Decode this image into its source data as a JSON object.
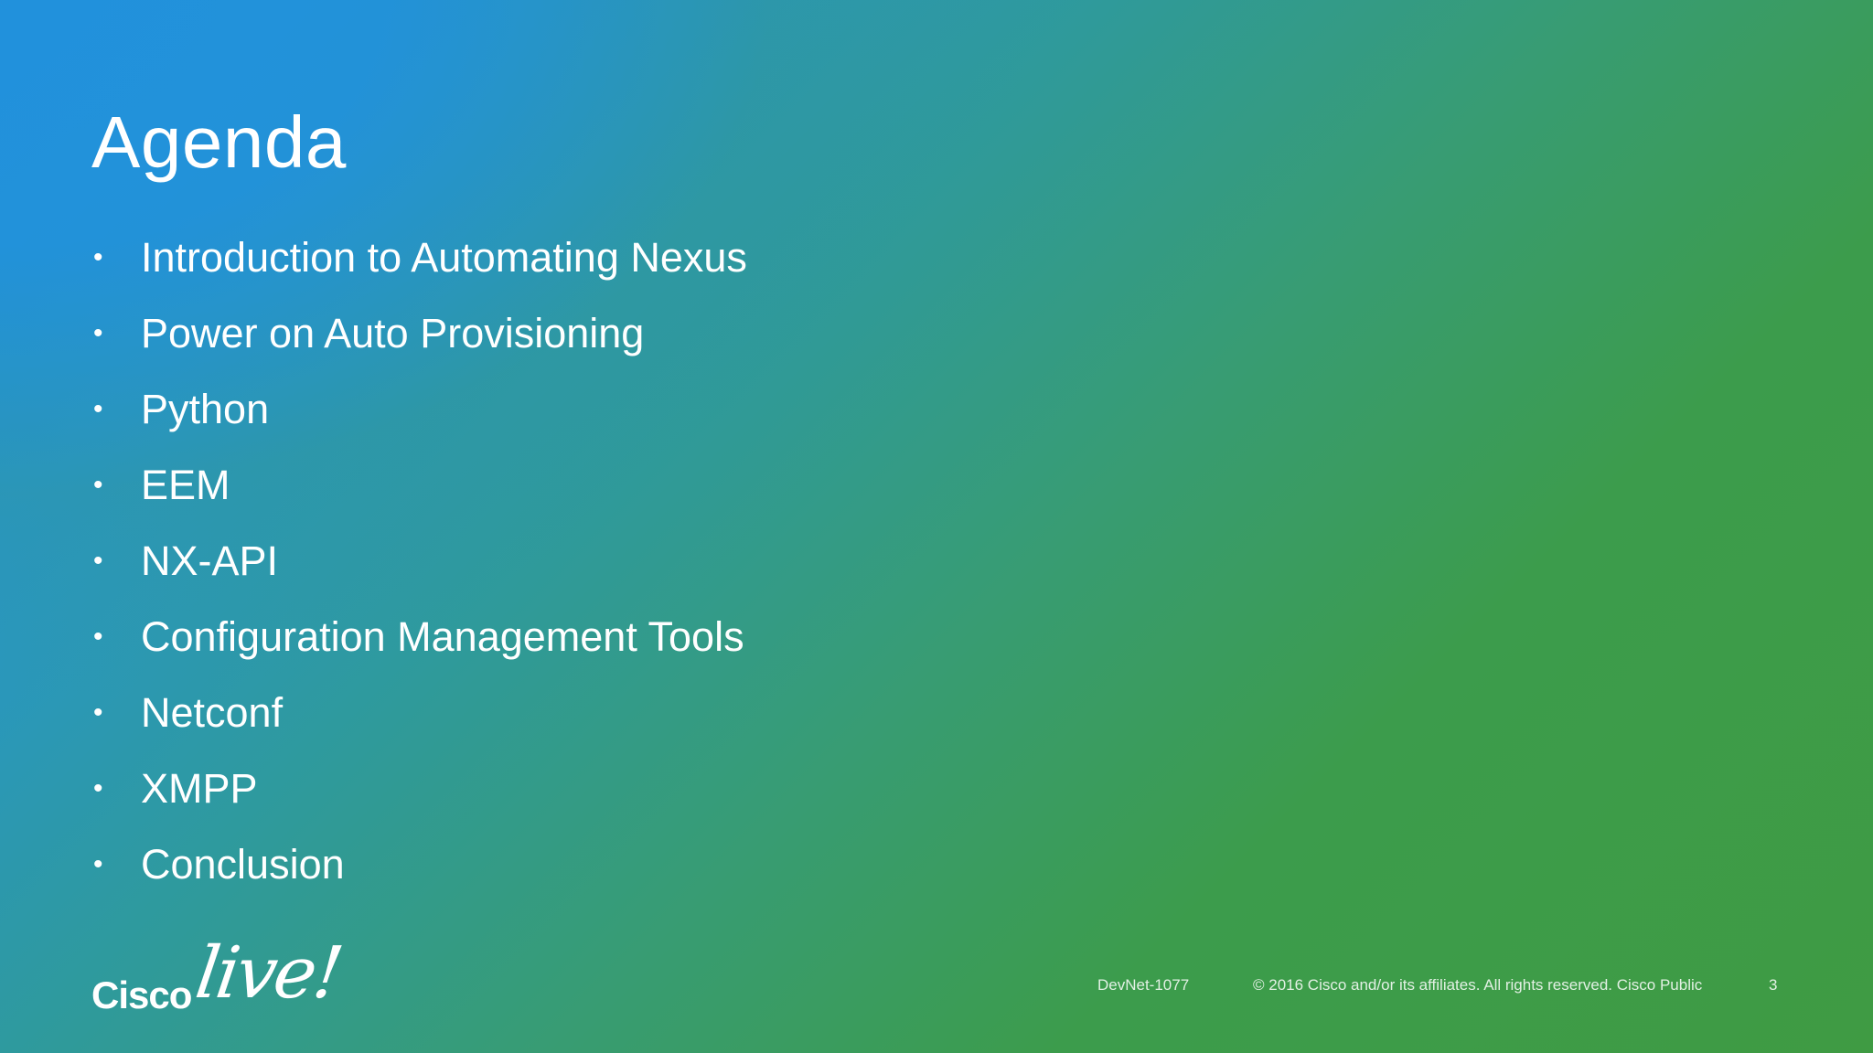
{
  "slide": {
    "title": "Agenda",
    "items": [
      {
        "bullet": "•",
        "label": "Introduction to Automating Nexus"
      },
      {
        "bullet": "•",
        "label": "Power on Auto Provisioning"
      },
      {
        "bullet": "•",
        "label": "Python"
      },
      {
        "bullet": "•",
        "label": "EEM"
      },
      {
        "bullet": "•",
        "label": "NX-API"
      },
      {
        "bullet": "•",
        "label": "Configuration Management Tools"
      },
      {
        "bullet": "•",
        "label": "Netconf"
      },
      {
        "bullet": "•",
        "label": "XMPP"
      },
      {
        "bullet": "•",
        "label": "Conclusion"
      }
    ]
  },
  "logo": {
    "brand": "Cisco",
    "event": "live!"
  },
  "footer": {
    "session": "DevNet-1077",
    "copyright": "© 2016  Cisco and/or its affiliates. All rights reserved.   Cisco Public",
    "page_number": "3"
  },
  "colors": {
    "gradient_top_left": "#2292db",
    "gradient_bottom_right": "#3f9b43",
    "text": "#ffffff"
  }
}
